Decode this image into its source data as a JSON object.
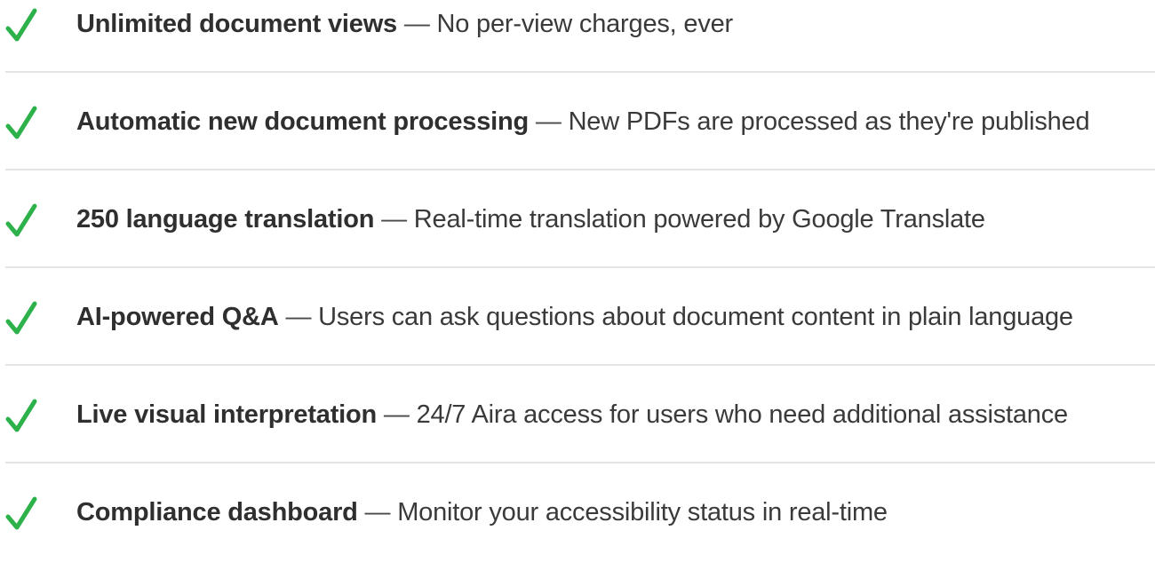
{
  "colors": {
    "check": "#2db14a",
    "divider": "#e4e4e4",
    "text": "#333333"
  },
  "features": [
    {
      "icon": "check-icon",
      "title": "Unlimited document views",
      "separator": "—",
      "description": "No per-view charges, ever"
    },
    {
      "icon": "check-icon",
      "title": "Automatic new document processing",
      "separator": "—",
      "description": "New PDFs are processed as they're published"
    },
    {
      "icon": "check-icon",
      "title": "250 language translation",
      "separator": "—",
      "description": "Real-time translation powered by Google Translate"
    },
    {
      "icon": "check-icon",
      "title": "AI-powered Q&A",
      "separator": "—",
      "description": "Users can ask questions about document content in plain language"
    },
    {
      "icon": "check-icon",
      "title": "Live visual interpretation",
      "separator": "—",
      "description": "24/7 Aira access for users who need additional assistance"
    },
    {
      "icon": "check-icon",
      "title": "Compliance dashboard",
      "separator": "—",
      "description": "Monitor your accessibility status in real-time"
    }
  ]
}
